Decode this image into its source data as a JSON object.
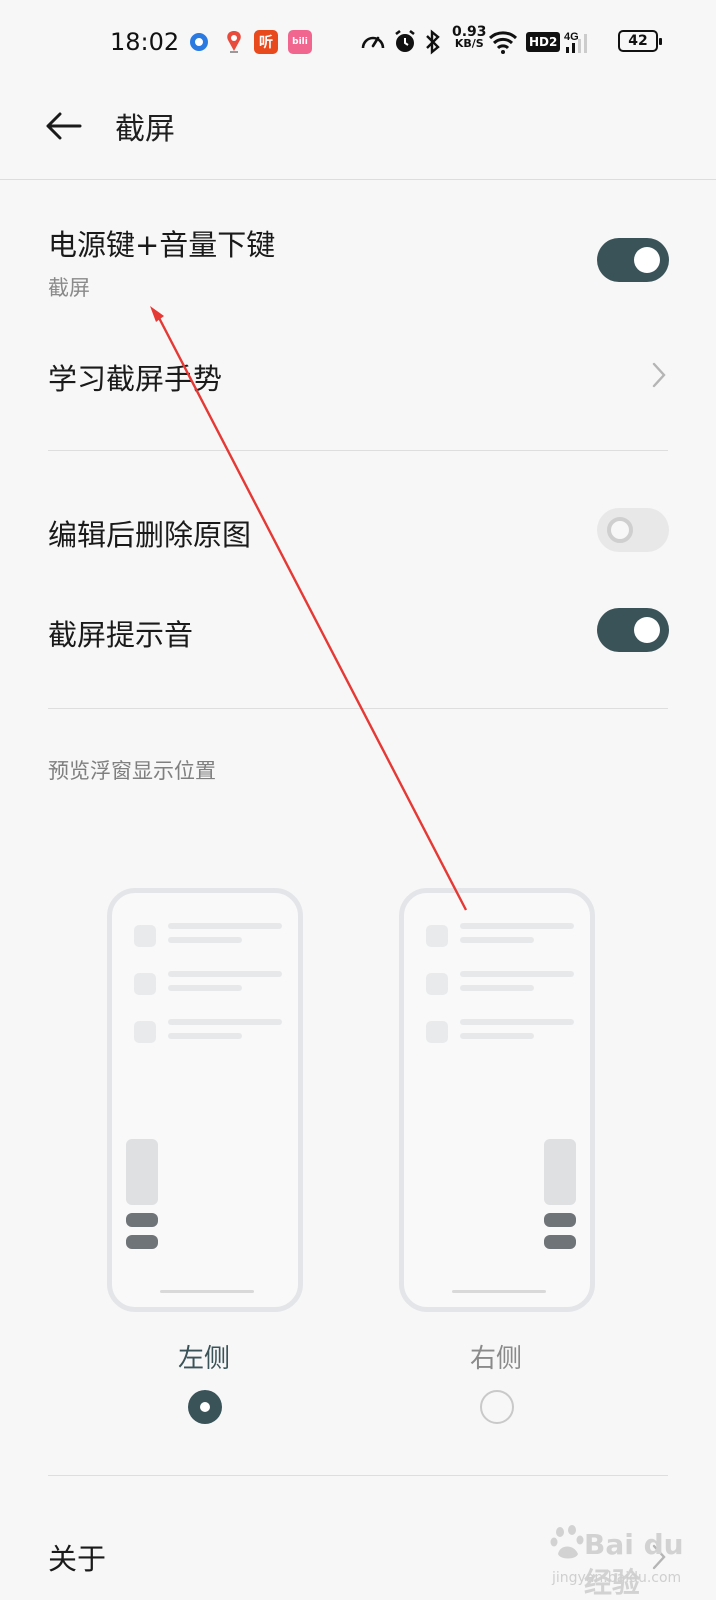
{
  "status_bar": {
    "time": "18:02",
    "net_speed_value": "0.93",
    "net_speed_unit": "KB/S",
    "hd_badge": "HD2",
    "network_type": "4G",
    "battery": "42",
    "app_icons": [
      "location-dot-icon",
      "maps-pin-icon",
      "listen-app-icon",
      "bilibili-app-icon"
    ],
    "listen_app_label": "听",
    "bili_app_label": "bili"
  },
  "header": {
    "title": "截屏"
  },
  "settings": {
    "power_volume": {
      "title": "电源键+音量下键",
      "subtitle": "截屏",
      "enabled": true
    },
    "learn_gesture": {
      "title": "学习截屏手势"
    },
    "delete_original": {
      "title": "编辑后删除原图",
      "enabled": false
    },
    "screenshot_sound": {
      "title": "截屏提示音",
      "enabled": true
    }
  },
  "preview_position": {
    "section_label": "预览浮窗显示位置",
    "left_label": "左侧",
    "right_label": "右侧",
    "selected": "left"
  },
  "about": {
    "title": "关于"
  },
  "watermark": {
    "brand": "Bai du 经验",
    "url": "jingyan.baidu.com"
  },
  "colors": {
    "accent": "#3a5358",
    "annotation_arrow": "#e53935"
  }
}
